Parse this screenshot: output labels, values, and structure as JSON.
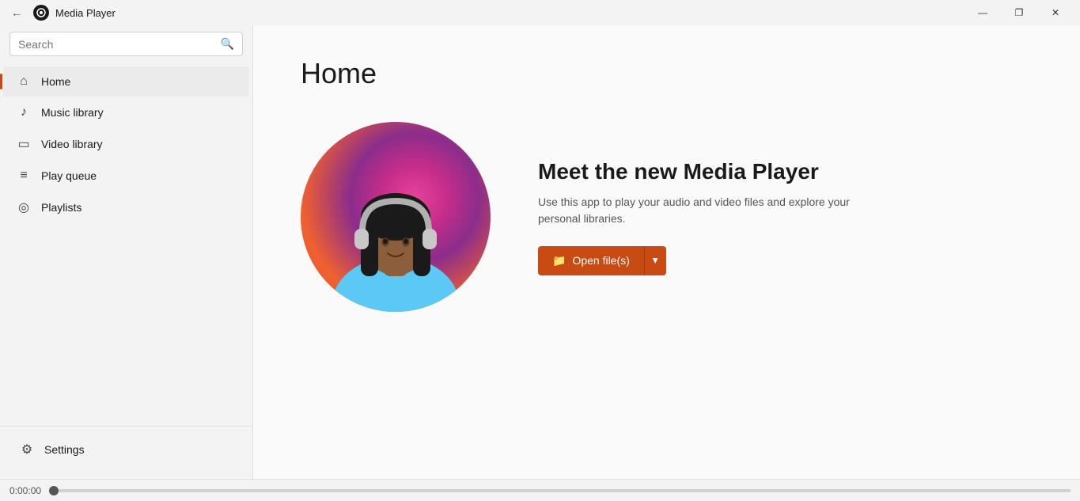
{
  "titlebar": {
    "title": "Media Player",
    "back_icon": "←",
    "minimize_label": "—",
    "maximize_label": "❐",
    "close_label": "✕"
  },
  "sidebar": {
    "search_placeholder": "Search",
    "nav_items": [
      {
        "id": "home",
        "label": "Home",
        "icon": "⌂",
        "active": true
      },
      {
        "id": "music-library",
        "label": "Music library",
        "icon": "♪",
        "active": false
      },
      {
        "id": "video-library",
        "label": "Video library",
        "icon": "▭",
        "active": false
      },
      {
        "id": "play-queue",
        "label": "Play queue",
        "icon": "≡",
        "active": false
      },
      {
        "id": "playlists",
        "label": "Playlists",
        "icon": "◎",
        "active": false
      }
    ],
    "settings_label": "Settings",
    "settings_icon": "⚙"
  },
  "main": {
    "page_title": "Home",
    "hero_title": "Meet the new Media Player",
    "hero_desc": "Use this app to play your audio and video files and explore your personal libraries.",
    "open_btn_label": "Open file(s)",
    "open_btn_icon": "📁"
  },
  "player": {
    "current_time": "0:00:00",
    "progress": 0
  }
}
